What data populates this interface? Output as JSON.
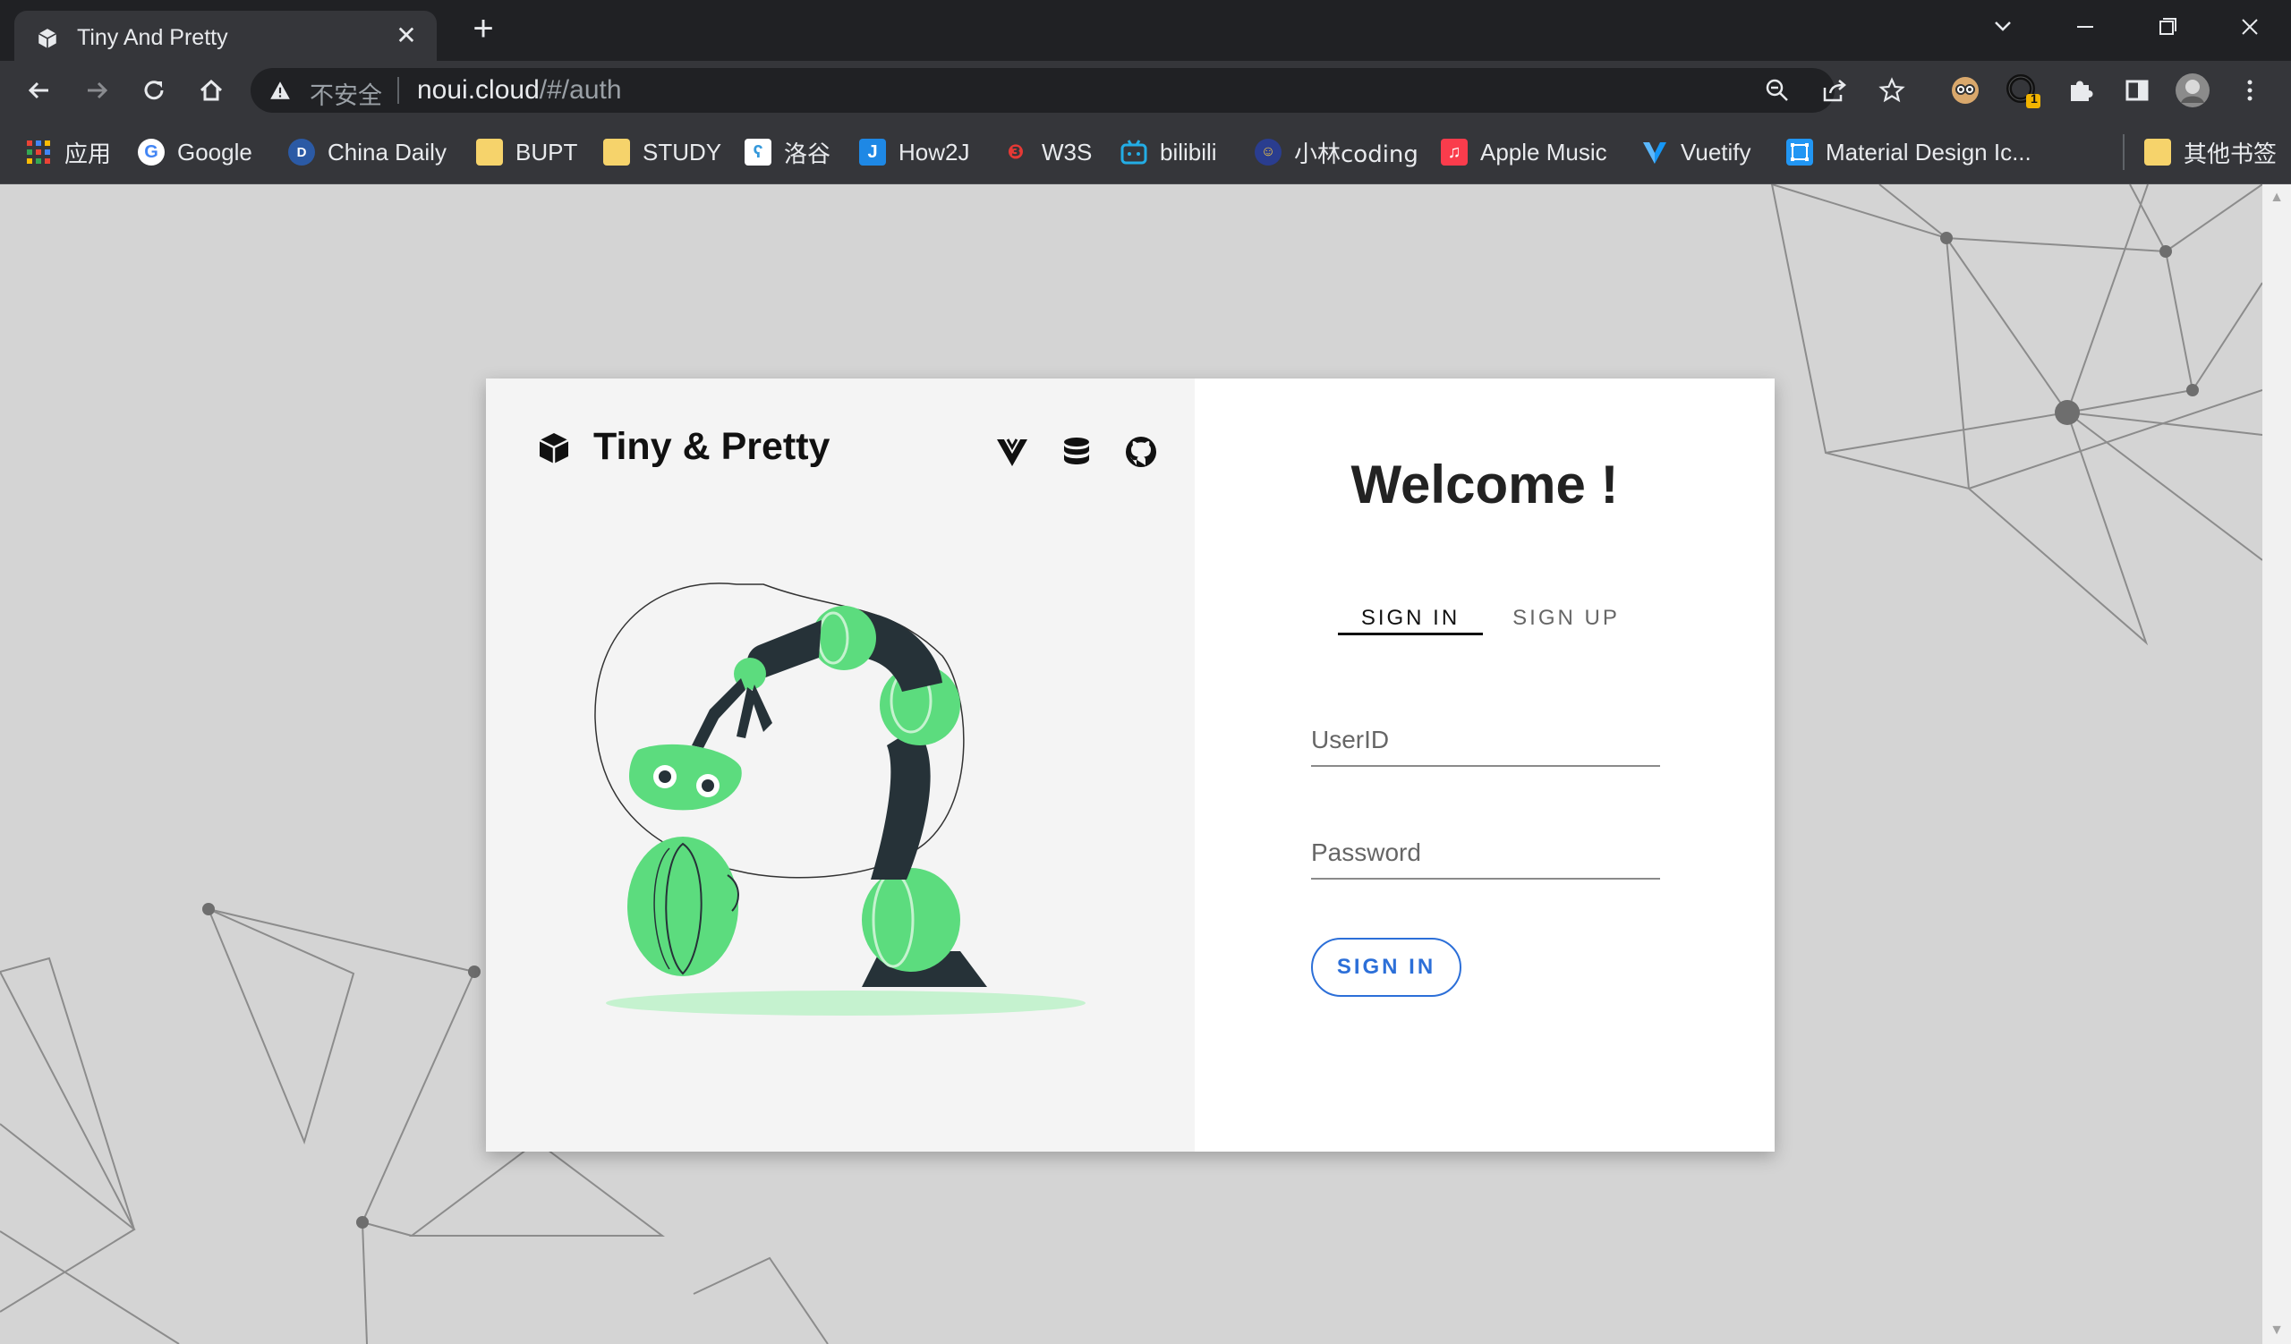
{
  "browser": {
    "tab_title": "Tiny And Pretty",
    "tab_close": "✕",
    "new_tab": "+",
    "insecure_label": "不安全",
    "url_host": "noui.cloud",
    "url_path": "/#/auth",
    "extension_badge": "1"
  },
  "bookmarks": [
    {
      "label": "应用",
      "icon": "apps-grid-icon"
    },
    {
      "label": "Google",
      "icon": "google-icon"
    },
    {
      "label": "China Daily",
      "icon": "china-daily-icon"
    },
    {
      "label": "BUPT",
      "icon": "folder-icon"
    },
    {
      "label": "STUDY",
      "icon": "folder-icon"
    },
    {
      "label": "洛谷",
      "icon": "luogu-icon"
    },
    {
      "label": "How2J",
      "icon": "how2j-icon"
    },
    {
      "label": "W3S",
      "icon": "w3s-icon"
    },
    {
      "label": "bilibili",
      "icon": "bilibili-icon"
    },
    {
      "label": "小林coding",
      "icon": "xiaolin-icon"
    },
    {
      "label": "Apple Music",
      "icon": "apple-music-icon"
    },
    {
      "label": "Vuetify",
      "icon": "vuetify-icon"
    },
    {
      "label": "Material Design Ic...",
      "icon": "material-design-icon"
    }
  ],
  "other_bookmarks": "其他书签",
  "brand": {
    "name": "Tiny & Pretty"
  },
  "auth": {
    "welcome": "Welcome !",
    "tab_signin": "SIGN IN",
    "tab_signup": "SIGN UP",
    "active_tab": "SIGN IN",
    "userid_label": "UserID",
    "password_label": "Password",
    "signin_button": "SIGN IN"
  },
  "colors": {
    "accent": "#2c6fd8",
    "robot_green": "#5cdc7e",
    "robot_dark": "#263238"
  }
}
